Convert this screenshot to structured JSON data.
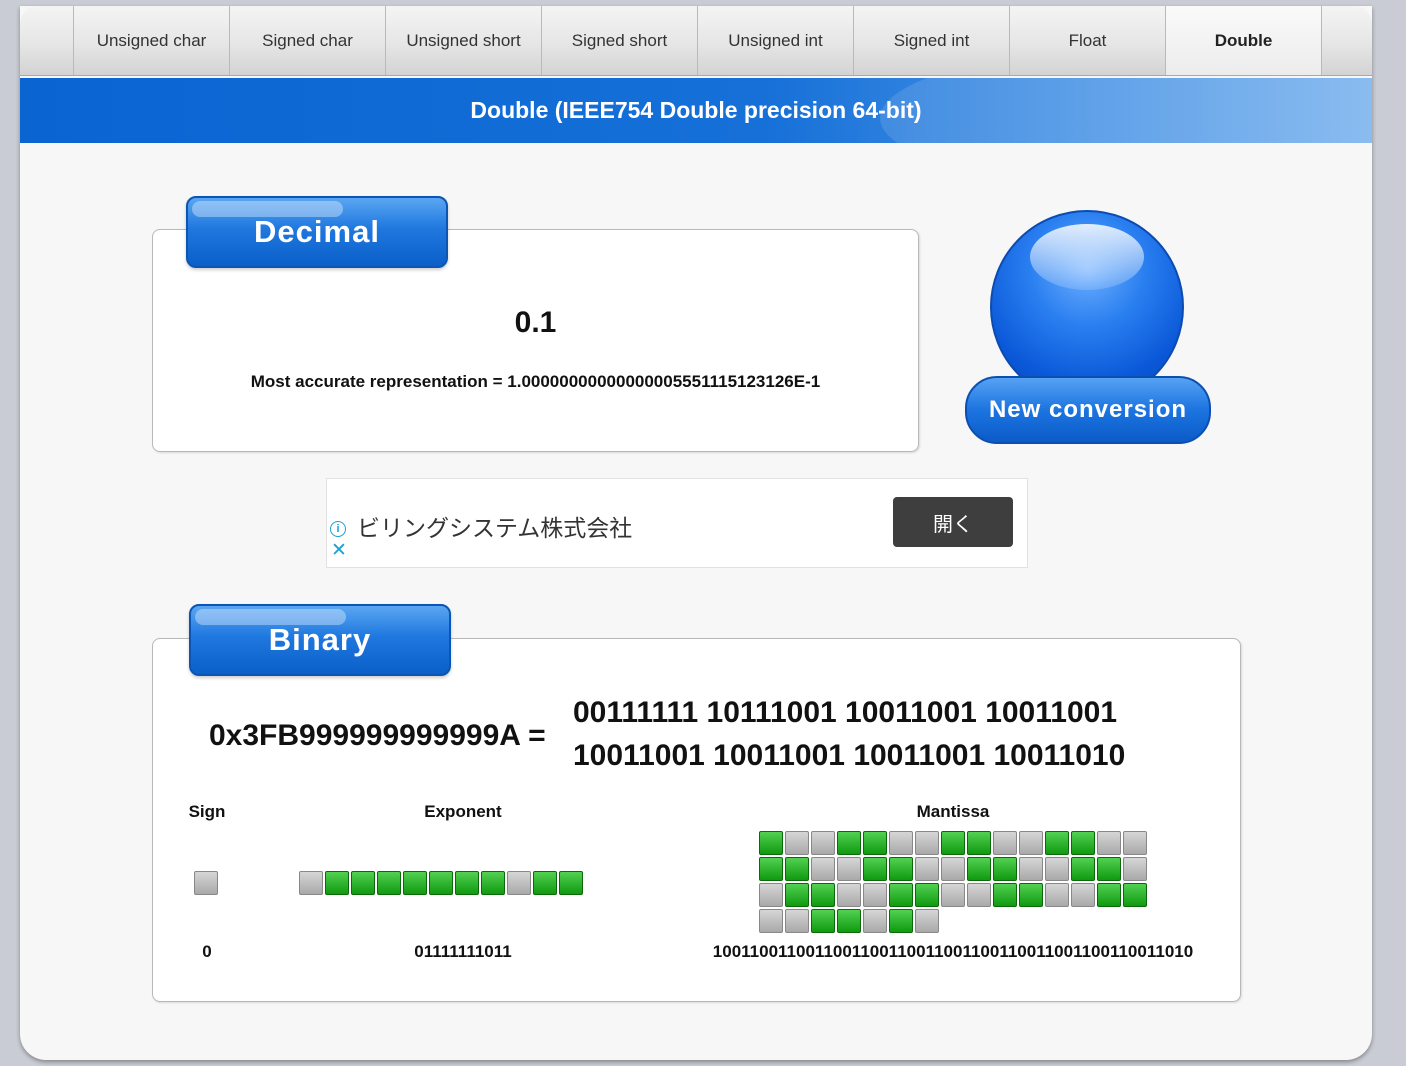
{
  "tabs": [
    {
      "label": "Unsigned char",
      "active": false
    },
    {
      "label": "Signed char",
      "active": false
    },
    {
      "label": "Unsigned short",
      "active": false
    },
    {
      "label": "Signed short",
      "active": false
    },
    {
      "label": "Unsigned int",
      "active": false
    },
    {
      "label": "Signed int",
      "active": false
    },
    {
      "label": "Float",
      "active": false
    },
    {
      "label": "Double",
      "active": true
    }
  ],
  "banner_title": "Double (IEEE754 Double precision 64-bit)",
  "decimal": {
    "label": "Decimal",
    "value": "0.1",
    "accurate": "Most accurate representation = 1.00000000000000005551115123126E-1"
  },
  "new_conversion_label": "New conversion",
  "ad": {
    "text": "ビリングシステム株式会社",
    "button_label": "開く",
    "info_icon": "info-icon",
    "close_icon": "close-icon"
  },
  "binary": {
    "label": "Binary",
    "hex": "0x3FB999999999999A =",
    "line1": "00111111 10111001 10011001 10011001",
    "line2": "10011001 10011001 10011001 10011010",
    "sign_title": "Sign",
    "exponent_title": "Exponent",
    "mantissa_title": "Mantissa",
    "sign_bits": "0",
    "exponent_bits": "01111111011",
    "mantissa_bits": "1001100110011001100110011001100110011001100110011010"
  },
  "colors": {
    "bit_one": "#1aa51a",
    "bit_zero": "#b5b5b5",
    "accent": "#0a64d2"
  }
}
